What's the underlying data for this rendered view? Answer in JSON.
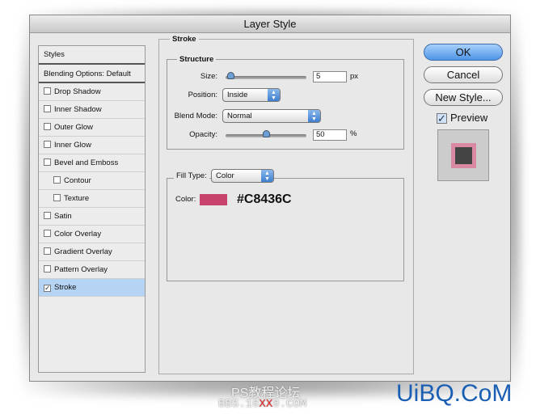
{
  "window": {
    "title": "Layer Style"
  },
  "styles_list": {
    "header": "Styles",
    "items": [
      {
        "label": "Blending Options: Default",
        "checkbox": false,
        "sub": false,
        "checked": false
      },
      {
        "label": "Drop Shadow",
        "checkbox": true,
        "sub": false,
        "checked": false
      },
      {
        "label": "Inner Shadow",
        "checkbox": true,
        "sub": false,
        "checked": false
      },
      {
        "label": "Outer Glow",
        "checkbox": true,
        "sub": false,
        "checked": false
      },
      {
        "label": "Inner Glow",
        "checkbox": true,
        "sub": false,
        "checked": false
      },
      {
        "label": "Bevel and Emboss",
        "checkbox": true,
        "sub": false,
        "checked": false
      },
      {
        "label": "Contour",
        "checkbox": true,
        "sub": true,
        "checked": false
      },
      {
        "label": "Texture",
        "checkbox": true,
        "sub": true,
        "checked": false
      },
      {
        "label": "Satin",
        "checkbox": true,
        "sub": false,
        "checked": false
      },
      {
        "label": "Color Overlay",
        "checkbox": true,
        "sub": false,
        "checked": false
      },
      {
        "label": "Gradient Overlay",
        "checkbox": true,
        "sub": false,
        "checked": false
      },
      {
        "label": "Pattern Overlay",
        "checkbox": true,
        "sub": false,
        "checked": false
      },
      {
        "label": "Stroke",
        "checkbox": true,
        "sub": false,
        "checked": true,
        "selected": true
      }
    ]
  },
  "stroke": {
    "title": "Stroke",
    "structure_title": "Structure",
    "size_label": "Size:",
    "size_value": "5",
    "size_unit": "px",
    "size_slider_fraction": 0.02,
    "position_label": "Position:",
    "position_value": "Inside",
    "blend_label": "Blend Mode:",
    "blend_value": "Normal",
    "opacity_label": "Opacity:",
    "opacity_value": "50",
    "opacity_unit": "%",
    "opacity_fraction": 0.5,
    "fill_type_label": "Fill Type:",
    "fill_type_value": "Color",
    "color_label": "Color:",
    "color_hex": "#C8436C"
  },
  "buttons": {
    "ok": "OK",
    "cancel": "Cancel",
    "new_style": "New Style...",
    "preview": "Preview",
    "preview_checked": true
  },
  "watermark": {
    "left_line1": "PS教程论坛",
    "left_line2_a": "BBS.16",
    "left_line2_b": "XX",
    "left_line2_c": "8.COM",
    "right": "UiBQ.CoM"
  }
}
